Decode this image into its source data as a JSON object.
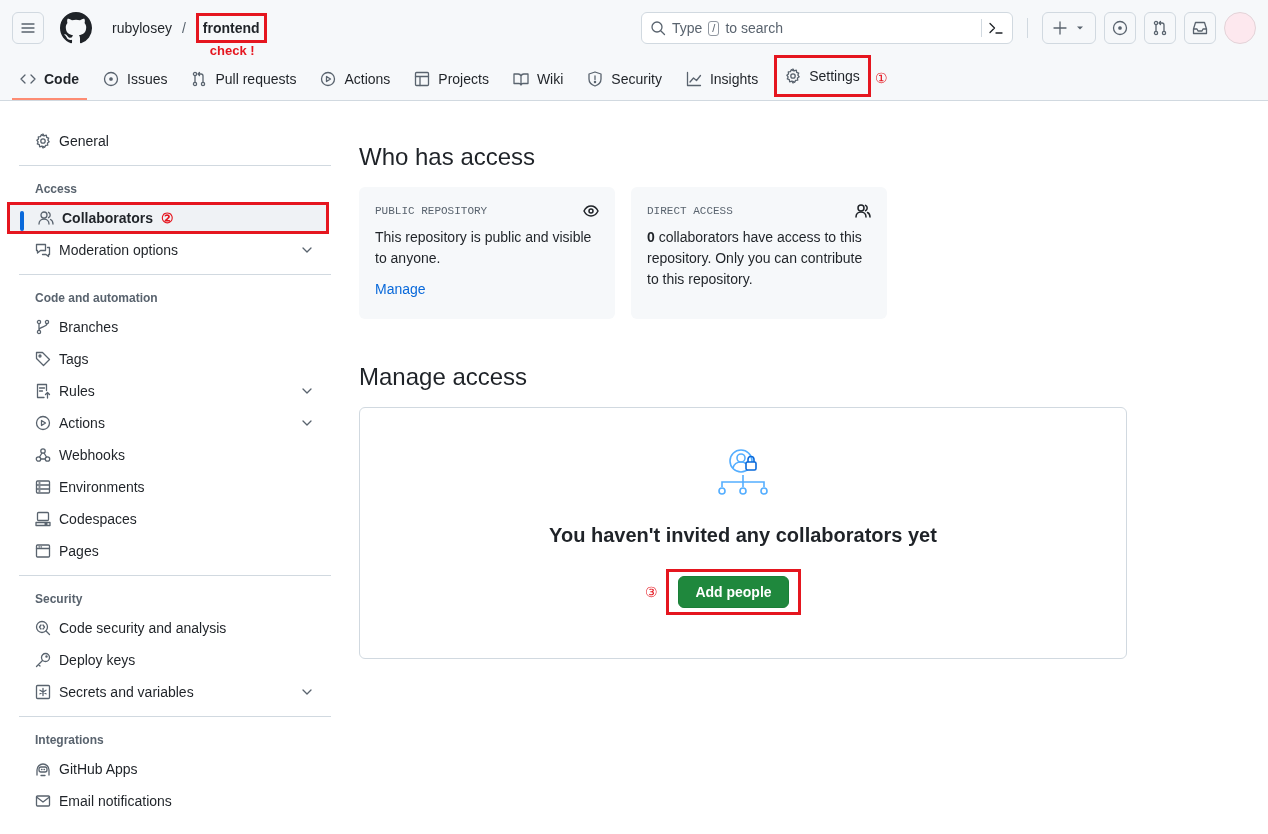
{
  "header": {
    "owner": "rubylosey",
    "separator": "/",
    "repo_name": "frontend",
    "repo_highlighted": true,
    "repo_note": "check !",
    "search": {
      "before": "Type",
      "key": "/",
      "after": "to search"
    }
  },
  "tabs": [
    {
      "label": "Code",
      "selected": true,
      "highlighted": false
    },
    {
      "label": "Issues",
      "selected": false,
      "highlighted": false
    },
    {
      "label": "Pull requests",
      "selected": false,
      "highlighted": false
    },
    {
      "label": "Actions",
      "selected": false,
      "highlighted": false
    },
    {
      "label": "Projects",
      "selected": false,
      "highlighted": false
    },
    {
      "label": "Wiki",
      "selected": false,
      "highlighted": false
    },
    {
      "label": "Security",
      "selected": false,
      "highlighted": false
    },
    {
      "label": "Insights",
      "selected": false,
      "highlighted": false
    },
    {
      "label": "Settings",
      "selected": false,
      "highlighted": true,
      "note": "①"
    }
  ],
  "sidebar": {
    "groups": [
      {
        "items": [
          {
            "label": "General",
            "selected": false,
            "highlighted": false,
            "has_menu": false
          }
        ]
      },
      {
        "heading": "Access",
        "items": [
          {
            "label": "Collaborators",
            "selected": true,
            "highlighted": true,
            "has_menu": false,
            "note": "②"
          },
          {
            "label": "Moderation options",
            "selected": false,
            "highlighted": false,
            "has_menu": true
          }
        ]
      },
      {
        "heading": "Code and automation",
        "items": [
          {
            "label": "Branches",
            "selected": false,
            "highlighted": false,
            "has_menu": false
          },
          {
            "label": "Tags",
            "selected": false,
            "highlighted": false,
            "has_menu": false
          },
          {
            "label": "Rules",
            "selected": false,
            "highlighted": false,
            "has_menu": true
          },
          {
            "label": "Actions",
            "selected": false,
            "highlighted": false,
            "has_menu": true
          },
          {
            "label": "Webhooks",
            "selected": false,
            "highlighted": false,
            "has_menu": false
          },
          {
            "label": "Environments",
            "selected": false,
            "highlighted": false,
            "has_menu": false
          },
          {
            "label": "Codespaces",
            "selected": false,
            "highlighted": false,
            "has_menu": false
          },
          {
            "label": "Pages",
            "selected": false,
            "highlighted": false,
            "has_menu": false
          }
        ]
      },
      {
        "heading": "Security",
        "items": [
          {
            "label": "Code security and analysis",
            "selected": false,
            "highlighted": false,
            "has_menu": false
          },
          {
            "label": "Deploy keys",
            "selected": false,
            "highlighted": false,
            "has_menu": false
          },
          {
            "label": "Secrets and variables",
            "selected": false,
            "highlighted": false,
            "has_menu": true
          }
        ]
      },
      {
        "heading": "Integrations",
        "items": [
          {
            "label": "GitHub Apps",
            "selected": false,
            "highlighted": false,
            "has_menu": false
          },
          {
            "label": "Email notifications",
            "selected": false,
            "highlighted": false,
            "has_menu": false
          }
        ]
      }
    ]
  },
  "who_has_access": {
    "title": "Who has access",
    "cards": [
      {
        "heading": "PUBLIC REPOSITORY",
        "body": "This repository is public and visible to anyone.",
        "link": "Manage"
      },
      {
        "heading": "DIRECT ACCESS",
        "body": "**0** collaborators have access to this repository. Only you can contribute to this repository."
      }
    ]
  },
  "manage_access": {
    "title": "Manage access",
    "message": "You haven't invited any collaborators yet",
    "button": {
      "label": "Add people",
      "highlighted": true,
      "note": "③"
    }
  }
}
